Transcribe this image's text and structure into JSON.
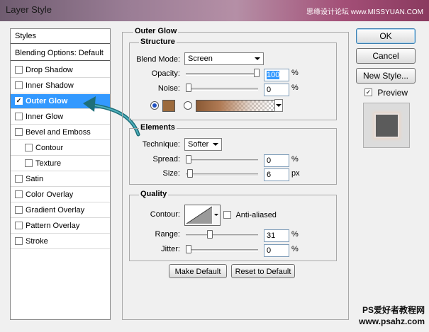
{
  "window": {
    "title": "Layer Style",
    "site": "思缘设计论坛  www.MISSYUAN.COM"
  },
  "styles_panel": {
    "header": "Styles",
    "blending": "Blending Options: Default",
    "items": [
      {
        "label": "Drop Shadow",
        "checked": false,
        "indent": false,
        "selected": false
      },
      {
        "label": "Inner Shadow",
        "checked": false,
        "indent": false,
        "selected": false
      },
      {
        "label": "Outer Glow",
        "checked": true,
        "indent": false,
        "selected": true
      },
      {
        "label": "Inner Glow",
        "checked": false,
        "indent": false,
        "selected": false
      },
      {
        "label": "Bevel and Emboss",
        "checked": false,
        "indent": false,
        "selected": false
      },
      {
        "label": "Contour",
        "checked": false,
        "indent": true,
        "selected": false
      },
      {
        "label": "Texture",
        "checked": false,
        "indent": true,
        "selected": false
      },
      {
        "label": "Satin",
        "checked": false,
        "indent": false,
        "selected": false
      },
      {
        "label": "Color Overlay",
        "checked": false,
        "indent": false,
        "selected": false
      },
      {
        "label": "Gradient Overlay",
        "checked": false,
        "indent": false,
        "selected": false
      },
      {
        "label": "Pattern Overlay",
        "checked": false,
        "indent": false,
        "selected": false
      },
      {
        "label": "Stroke",
        "checked": false,
        "indent": false,
        "selected": false
      }
    ]
  },
  "outer_glow": {
    "title": "Outer Glow",
    "structure": {
      "title": "Structure",
      "blend_mode_label": "Blend Mode:",
      "blend_mode": "Screen",
      "opacity_label": "Opacity:",
      "opacity": "100",
      "opacity_unit": "%",
      "opacity_level": 1.0,
      "noise_label": "Noise:",
      "noise": "0",
      "noise_unit": "%",
      "noise_level": 0.0,
      "glow_color": "#9c6a3c"
    },
    "elements": {
      "title": "Elements",
      "technique_label": "Technique:",
      "technique": "Softer",
      "spread_label": "Spread:",
      "spread": "0",
      "spread_unit": "%",
      "spread_level": 0.0,
      "size_label": "Size:",
      "size": "6",
      "size_unit": "px",
      "size_level": 0.024
    },
    "quality": {
      "title": "Quality",
      "contour_label": "Contour:",
      "anti_aliased_label": "Anti-aliased",
      "anti_aliased": false,
      "range_label": "Range:",
      "range": "31",
      "range_unit": "%",
      "range_level": 0.31,
      "jitter_label": "Jitter:",
      "jitter": "0",
      "jitter_unit": "%",
      "jitter_level": 0.0
    },
    "make_default": "Make Default",
    "reset_default": "Reset to Default"
  },
  "right_panel": {
    "ok": "OK",
    "cancel": "Cancel",
    "new_style": "New Style...",
    "preview_label": "Preview",
    "preview_checked": true
  },
  "watermark": {
    "line1": "PS爱好者教程网",
    "line2": "www.psahz.com"
  },
  "colors": {
    "selection": "#3399ff",
    "arrow": "#1e6f7a"
  }
}
